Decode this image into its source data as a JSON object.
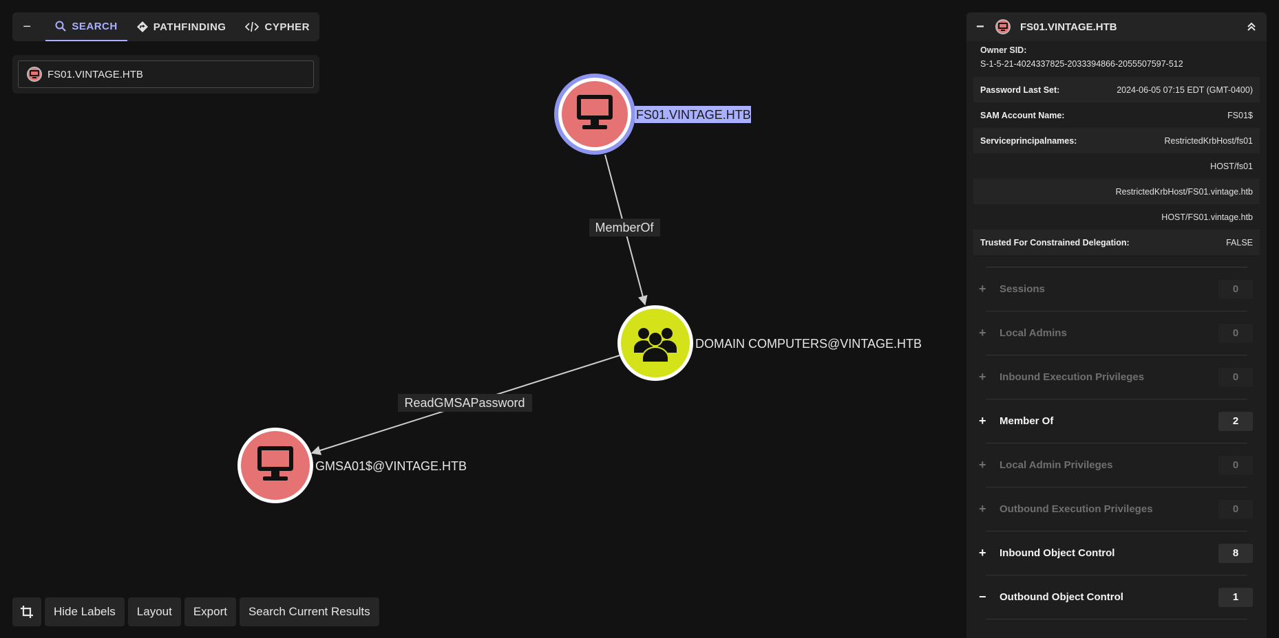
{
  "nav": {
    "collapse": "−",
    "tabs": [
      {
        "label": "SEARCH",
        "icon": "search-icon"
      },
      {
        "label": "PATHFINDING",
        "icon": "pathfinding-icon"
      },
      {
        "label": "CYPHER",
        "icon": "code-icon"
      }
    ]
  },
  "search": {
    "value": "FS01.VINTAGE.HTB"
  },
  "graph": {
    "nodes": [
      {
        "label": "FS01.VINTAGE.HTB",
        "type": "computer",
        "selected": true
      },
      {
        "label": "DOMAIN COMPUTERS@VINTAGE.HTB",
        "type": "group"
      },
      {
        "label": "GMSA01$@VINTAGE.HTB",
        "type": "computer"
      }
    ],
    "edges": [
      {
        "label": "MemberOf",
        "from": "FS01.VINTAGE.HTB",
        "to": "DOMAIN COMPUTERS@VINTAGE.HTB"
      },
      {
        "label": "ReadGMSAPassword",
        "from": "DOMAIN COMPUTERS@VINTAGE.HTB",
        "to": "GMSA01$@VINTAGE.HTB"
      }
    ],
    "colors": {
      "computer": "#e57373",
      "group": "#d4e21a",
      "selected_ring": "#8e95f0",
      "label_highlight": "#a8b0ff"
    }
  },
  "toolbar": {
    "hide_labels": "Hide Labels",
    "layout": "Layout",
    "export": "Export",
    "search_results": "Search Current Results"
  },
  "panel": {
    "title": "FS01.VINTAGE.HTB",
    "collapse": "−",
    "owner_sid_key": "Owner SID:",
    "owner_sid_val": "S-1-5-21-4024337825-2033394866-2055507597-512",
    "properties": [
      {
        "key": "Password Last Set:",
        "value": "2024-06-05 07:15 EDT (GMT-0400)"
      },
      {
        "key": "SAM Account Name:",
        "value": "FS01$"
      },
      {
        "key": "Serviceprincipalnames:",
        "value": "RestrictedKrbHost/fs01"
      },
      {
        "key": "",
        "value": "HOST/fs01"
      },
      {
        "key": "",
        "value": "RestrictedKrbHost/FS01.vintage.htb"
      },
      {
        "key": "",
        "value": "HOST/FS01.vintage.htb"
      },
      {
        "key": "Trusted For Constrained Delegation:",
        "value": "FALSE"
      }
    ],
    "sections": [
      {
        "label": "Sessions",
        "count": "0",
        "sign": "+",
        "active": false
      },
      {
        "label": "Local Admins",
        "count": "0",
        "sign": "+",
        "active": false
      },
      {
        "label": "Inbound Execution Privileges",
        "count": "0",
        "sign": "+",
        "active": false
      },
      {
        "label": "Member Of",
        "count": "2",
        "sign": "+",
        "active": true
      },
      {
        "label": "Local Admin Privileges",
        "count": "0",
        "sign": "+",
        "active": false
      },
      {
        "label": "Outbound Execution Privileges",
        "count": "0",
        "sign": "+",
        "active": false
      },
      {
        "label": "Inbound Object Control",
        "count": "8",
        "sign": "+",
        "active": true
      },
      {
        "label": "Outbound Object Control",
        "count": "1",
        "sign": "−",
        "active": true
      }
    ]
  }
}
